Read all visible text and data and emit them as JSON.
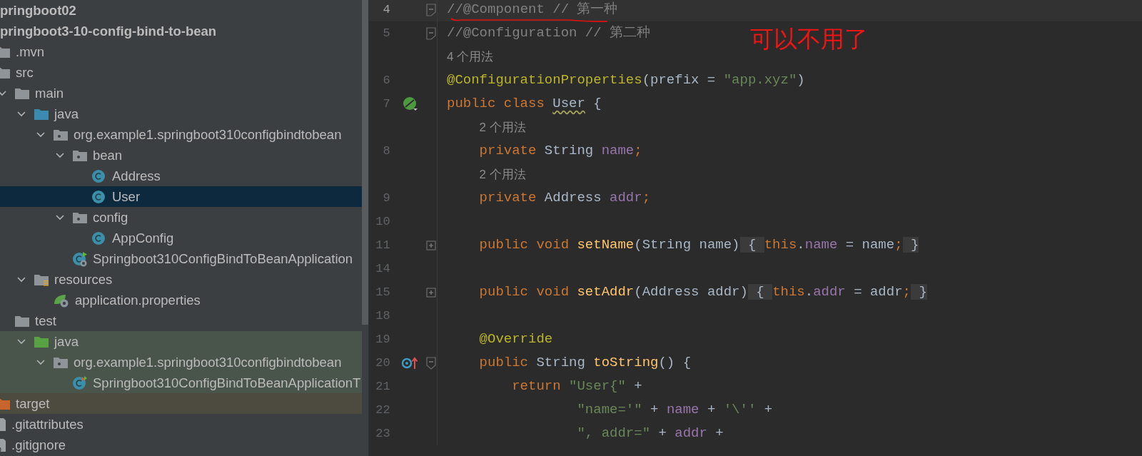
{
  "project_tree": [
    {
      "label": "pringboot02",
      "kind": "module"
    },
    {
      "label": "pringboot3-10-config-bind-to-bean",
      "kind": "module",
      "children": [
        {
          "label": ".mvn",
          "kind": "folder"
        },
        {
          "label": "src",
          "kind": "folder",
          "children": [
            {
              "label": "main",
              "kind": "folder",
              "expanded": true,
              "children": [
                {
                  "label": "java",
                  "kind": "source-folder",
                  "expanded": true,
                  "children": [
                    {
                      "label": "org.example1.springboot310configbindtobean",
                      "kind": "package",
                      "expanded": true,
                      "children": [
                        {
                          "label": "bean",
                          "kind": "package",
                          "expanded": true,
                          "children": [
                            {
                              "label": "Address",
                              "kind": "class",
                              "selected": false
                            },
                            {
                              "label": "User",
                              "kind": "class",
                              "selected": true
                            }
                          ]
                        },
                        {
                          "label": "config",
                          "kind": "package",
                          "expanded": true,
                          "children": [
                            {
                              "label": "AppConfig",
                              "kind": "class",
                              "selected": false
                            }
                          ]
                        },
                        {
                          "label": "Springboot310ConfigBindToBeanApplication",
                          "kind": "spring-app",
                          "selected": false
                        }
                      ]
                    }
                  ]
                },
                {
                  "label": "resources",
                  "kind": "resources-folder",
                  "expanded": true,
                  "children": [
                    {
                      "label": "application.properties",
                      "kind": "properties",
                      "selected": false
                    }
                  ]
                }
              ]
            },
            {
              "label": "test",
              "kind": "folder",
              "children": [
                {
                  "label": "java",
                  "kind": "test-folder",
                  "test_scope": true,
                  "expanded": true,
                  "children": [
                    {
                      "label": "org.example1.springboot310configbindtobean",
                      "kind": "package",
                      "test_scope": true,
                      "expanded": true,
                      "children": [
                        {
                          "label": "Springboot310ConfigBindToBeanApplicationT",
                          "kind": "spring-test",
                          "test_scope": true,
                          "selected": false
                        }
                      ]
                    }
                  ]
                }
              ]
            }
          ]
        },
        {
          "label": "target",
          "kind": "excluded-folder",
          "excluded": true
        },
        {
          "label": ".gitattributes",
          "kind": "file"
        },
        {
          "label": ".gitignore",
          "kind": "ignore-file"
        }
      ]
    }
  ],
  "editor": {
    "annotation": "可以不用了",
    "lines": [
      {
        "kind": "code",
        "number": "4",
        "current": true,
        "fold": {
          "kind": "start"
        },
        "tokens": [
          {
            "t": "//",
            "kind": "comment"
          },
          {
            "t": "@Component // 第一种",
            "kind": "comment"
          }
        ]
      },
      {
        "kind": "code",
        "number": "5",
        "current": false,
        "fold": {
          "kind": "start"
        },
        "tokens": [
          {
            "t": "//@Configuration // 第二种",
            "kind": "comment"
          }
        ]
      },
      {
        "kind": "usage",
        "text": "4 个用法"
      },
      {
        "kind": "code",
        "number": "6",
        "current": false,
        "tokens": [
          {
            "t": "@ConfigurationProperties",
            "kind": "annotation"
          },
          {
            "t": "(prefix = ",
            "kind": "plain"
          },
          {
            "t": "\"app.xyz\"",
            "kind": "string"
          },
          {
            "t": ")",
            "kind": "plain"
          }
        ]
      },
      {
        "kind": "code",
        "number": "7",
        "current": false,
        "gutter_icon": {
          "kind": "bean"
        },
        "tokens": [
          {
            "t": "public class ",
            "kind": "keyword"
          },
          {
            "t": "User",
            "kind": "typo"
          },
          {
            "t": " {",
            "kind": "plain"
          }
        ]
      },
      {
        "kind": "usage",
        "text": "2 个用法"
      },
      {
        "kind": "code",
        "number": "8",
        "current": false,
        "tokens": [
          {
            "t": "    private ",
            "kind": "keyword"
          },
          {
            "t": "String ",
            "kind": "plain"
          },
          {
            "t": "name",
            "kind": "field"
          },
          {
            "t": ";",
            "kind": "keyword"
          }
        ]
      },
      {
        "kind": "usage",
        "text": "2 个用法"
      },
      {
        "kind": "code",
        "number": "9",
        "current": false,
        "tokens": [
          {
            "t": "    private ",
            "kind": "keyword"
          },
          {
            "t": "Address ",
            "kind": "plain"
          },
          {
            "t": "addr",
            "kind": "field"
          },
          {
            "t": ";",
            "kind": "keyword"
          }
        ]
      },
      {
        "kind": "code",
        "number": "10",
        "current": false
      },
      {
        "kind": "code",
        "number": "11",
        "current": false,
        "fold": {
          "kind": "collapsed"
        },
        "tokens": [
          {
            "t": "    public void ",
            "kind": "keyword"
          },
          {
            "t": "setName",
            "kind": "method"
          },
          {
            "t": "(String name)",
            "kind": "plain"
          },
          {
            "t": " { ",
            "kind": "folded"
          },
          {
            "t": "this",
            "kind": "keyword"
          },
          {
            "t": ".",
            "kind": "plain"
          },
          {
            "t": "name",
            "kind": "field"
          },
          {
            "t": " = name",
            "kind": "plain"
          },
          {
            "t": ";",
            "kind": "keyword"
          },
          {
            "t": " }",
            "kind": "folded"
          }
        ]
      },
      {
        "kind": "code",
        "number": "14",
        "current": false
      },
      {
        "kind": "code",
        "number": "15",
        "current": false,
        "fold": {
          "kind": "collapsed"
        },
        "tokens": [
          {
            "t": "    public void ",
            "kind": "keyword"
          },
          {
            "t": "setAddr",
            "kind": "method"
          },
          {
            "t": "(Address addr)",
            "kind": "plain"
          },
          {
            "t": " { ",
            "kind": "folded"
          },
          {
            "t": "this",
            "kind": "keyword"
          },
          {
            "t": ".",
            "kind": "plain"
          },
          {
            "t": "addr",
            "kind": "field"
          },
          {
            "t": " = addr",
            "kind": "plain"
          },
          {
            "t": ";",
            "kind": "keyword"
          },
          {
            "t": " }",
            "kind": "folded"
          }
        ]
      },
      {
        "kind": "code",
        "number": "18",
        "current": false
      },
      {
        "kind": "code",
        "number": "19",
        "current": false,
        "tokens": [
          {
            "t": "    @Override",
            "kind": "annotation"
          }
        ]
      },
      {
        "kind": "code",
        "number": "20",
        "current": false,
        "gutter_icon": {
          "kind": "override"
        },
        "fold": {
          "kind": "end"
        },
        "tokens": [
          {
            "t": "    public ",
            "kind": "keyword"
          },
          {
            "t": "String ",
            "kind": "plain"
          },
          {
            "t": "toString",
            "kind": "method"
          },
          {
            "t": "() {",
            "kind": "plain"
          }
        ]
      },
      {
        "kind": "code",
        "number": "21",
        "current": false,
        "tokens": [
          {
            "t": "        return ",
            "kind": "keyword"
          },
          {
            "t": "\"User{\"",
            "kind": "string"
          },
          {
            "t": " +",
            "kind": "plain"
          }
        ]
      },
      {
        "kind": "code",
        "number": "22",
        "current": false,
        "tokens": [
          {
            "t": "                \"name='\"",
            "kind": "string"
          },
          {
            "t": " + ",
            "kind": "plain"
          },
          {
            "t": "name",
            "kind": "field"
          },
          {
            "t": " + ",
            "kind": "plain"
          },
          {
            "t": "'\\''",
            "kind": "string"
          },
          {
            "t": " +",
            "kind": "plain"
          }
        ]
      },
      {
        "kind": "code",
        "number": "23",
        "current": false,
        "tokens": [
          {
            "t": "                \", addr=\"",
            "kind": "string"
          },
          {
            "t": " + ",
            "kind": "plain"
          },
          {
            "t": "addr",
            "kind": "field"
          },
          {
            "t": " +",
            "kind": "plain"
          }
        ]
      }
    ]
  }
}
